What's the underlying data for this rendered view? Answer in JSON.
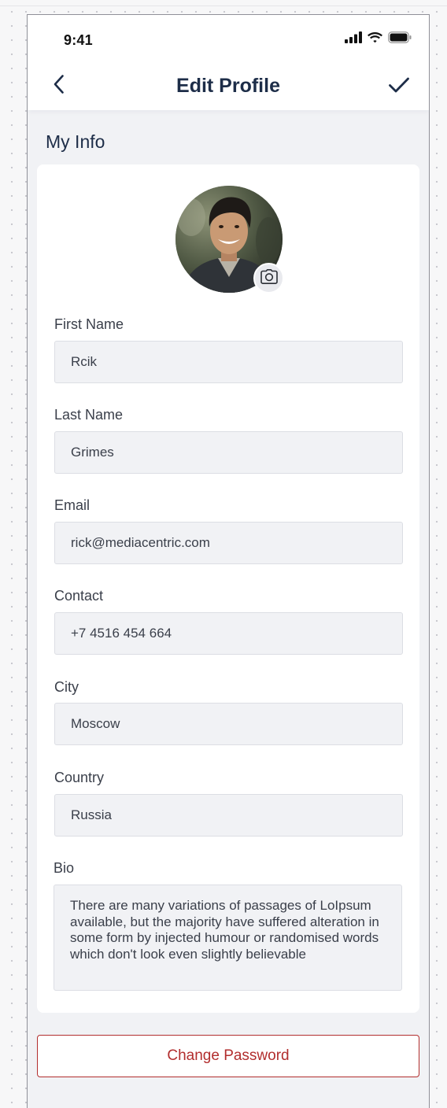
{
  "status_bar": {
    "time": "9:41",
    "signal_icon": "cellular-signal-icon",
    "wifi_icon": "wifi-icon",
    "battery_icon": "battery-icon"
  },
  "nav": {
    "back_icon": "chevron-left-icon",
    "title": "Edit Profile",
    "confirm_icon": "checkmark-icon"
  },
  "section": {
    "title": "My Info"
  },
  "profile": {
    "avatar": "profile-photo",
    "camera_icon": "camera-icon"
  },
  "fields": {
    "first_name": {
      "label": "First Name",
      "value": "Rcik"
    },
    "last_name": {
      "label": "Last Name",
      "value": "Grimes"
    },
    "email": {
      "label": "Email",
      "value": "rick@mediacentric.com"
    },
    "contact": {
      "label": "Contact",
      "value": "+7 4516 454 664"
    },
    "city": {
      "label": "City",
      "value": "Moscow"
    },
    "country": {
      "label": "Country",
      "value": "Russia"
    },
    "bio": {
      "label": "Bio",
      "value": "There are many variations of passages of LoIpsum available, but the majority have suffered alteration in some form by injected humour or randomised words which don't look even slightly believable"
    }
  },
  "actions": {
    "change_password": "Change Password"
  },
  "colors": {
    "title_navy": "#1d2d48",
    "danger_red": "#b22e2e",
    "field_bg": "#f1f2f5",
    "screen_bg": "#f1f2f5",
    "card_bg": "#ffffff"
  }
}
